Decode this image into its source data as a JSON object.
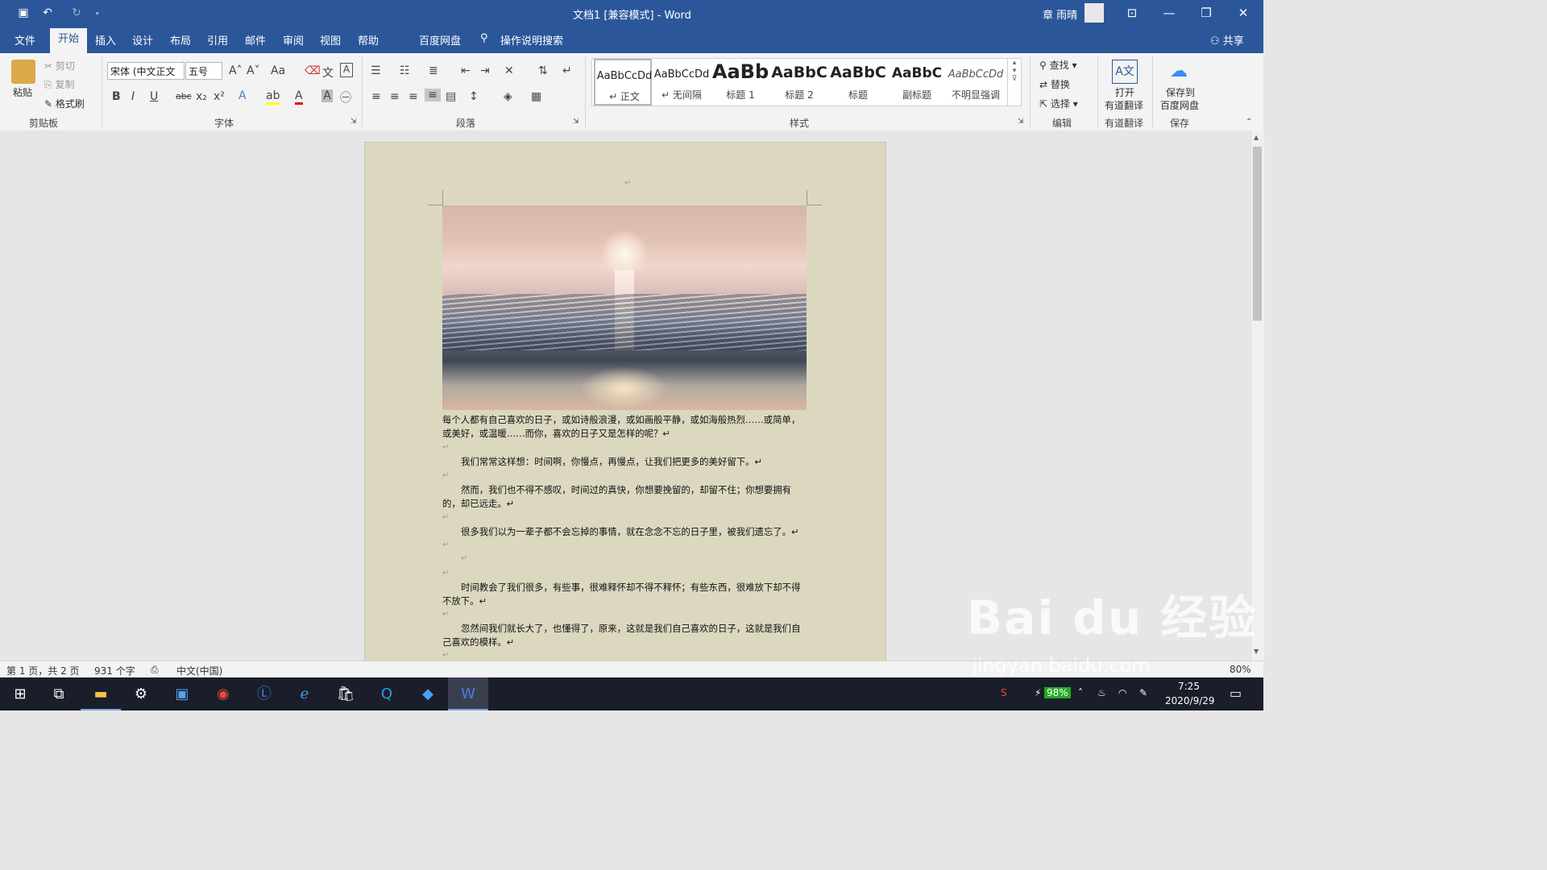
{
  "window": {
    "title": "文档1 [兼容模式]  -  Word",
    "user": "章 雨晴"
  },
  "quick_access": {
    "save": "save-icon",
    "undo": "undo-icon",
    "redo": "redo-icon",
    "customize": "ₑ"
  },
  "window_controls": {
    "ribbon_options": "⊡",
    "minimize": "—",
    "restore": "❐",
    "close": "✕"
  },
  "menu_tabs": [
    "文件",
    "开始",
    "插入",
    "设计",
    "布局",
    "引用",
    "邮件",
    "审阅",
    "视图",
    "帮助",
    "百度网盘",
    "操作说明搜索"
  ],
  "share": "共享",
  "clipboard": {
    "paste": "粘贴",
    "cut": "剪切",
    "copy": "复制",
    "format_painter": "格式刷",
    "label": "剪贴板"
  },
  "font": {
    "name": "宋体 (中文正文",
    "size": "五号",
    "label": "字体",
    "case": "Aa"
  },
  "paragraph": {
    "label": "段落"
  },
  "styles": {
    "label": "样式",
    "items": [
      {
        "preview": "AaBbCcDd",
        "name": "↵ 正文"
      },
      {
        "preview": "AaBbCcDd",
        "name": "↵ 无间隔"
      },
      {
        "preview": "AaBb",
        "name": "标题 1"
      },
      {
        "preview": "AaBbC",
        "name": "标题 2"
      },
      {
        "preview": "AaBbC",
        "name": "标题"
      },
      {
        "preview": "AaBbC",
        "name": "副标题"
      },
      {
        "preview": "AaBbCcDd",
        "name": "不明显强调"
      }
    ]
  },
  "editing": {
    "find": "查找",
    "replace": "替换",
    "select": "选择",
    "label": "编辑"
  },
  "translate": {
    "open": "打开",
    "open2": "有道翻译",
    "label": "有道翻译"
  },
  "save_group": {
    "btn1": "保存到",
    "btn2": "百度网盘",
    "label": "保存"
  },
  "document": {
    "paragraphs": [
      "每个人都有自己喜欢的日子，或如诗般浪漫，或如画般平静，或如海般热烈……或简单，或美好，或温暖……而你，喜欢的日子又是怎样的呢？↵",
      "我们常常这样想：时间啊，你慢点，再慢点，让我们把更多的美好留下。↵",
      "然而，我们也不得不感叹，时间过的真快，你想要挽留的，却留不住；你想要拥有的，却已远走。↵",
      "很多我们以为一辈子都不会忘掉的事情，就在念念不忘的日子里，被我们遗忘了。↵",
      "时间教会了我们很多，有些事，很难释怀却不得不释怀；有些东西，很难放下却不得不放下。↵",
      "忽然间我们就长大了，也懂得了，原来，这就是我们自己喜欢的日子，这就是我们自己喜欢的模样。↵"
    ],
    "marks": [
      "↵",
      "↵",
      "↵",
      "↵",
      "↵",
      "↵",
      "↵",
      "↵",
      "↵"
    ]
  },
  "status": {
    "page": "第 1 页，共 2 页",
    "words": "931 个字",
    "lang": "中文(中国)",
    "zoom": "80%"
  },
  "taskbar": {
    "battery": "98%",
    "time": "7:25",
    "date": "2020/9/29"
  },
  "watermark": {
    "main": "Bai du 经验",
    "sub": "jingyan.baidu.com"
  }
}
